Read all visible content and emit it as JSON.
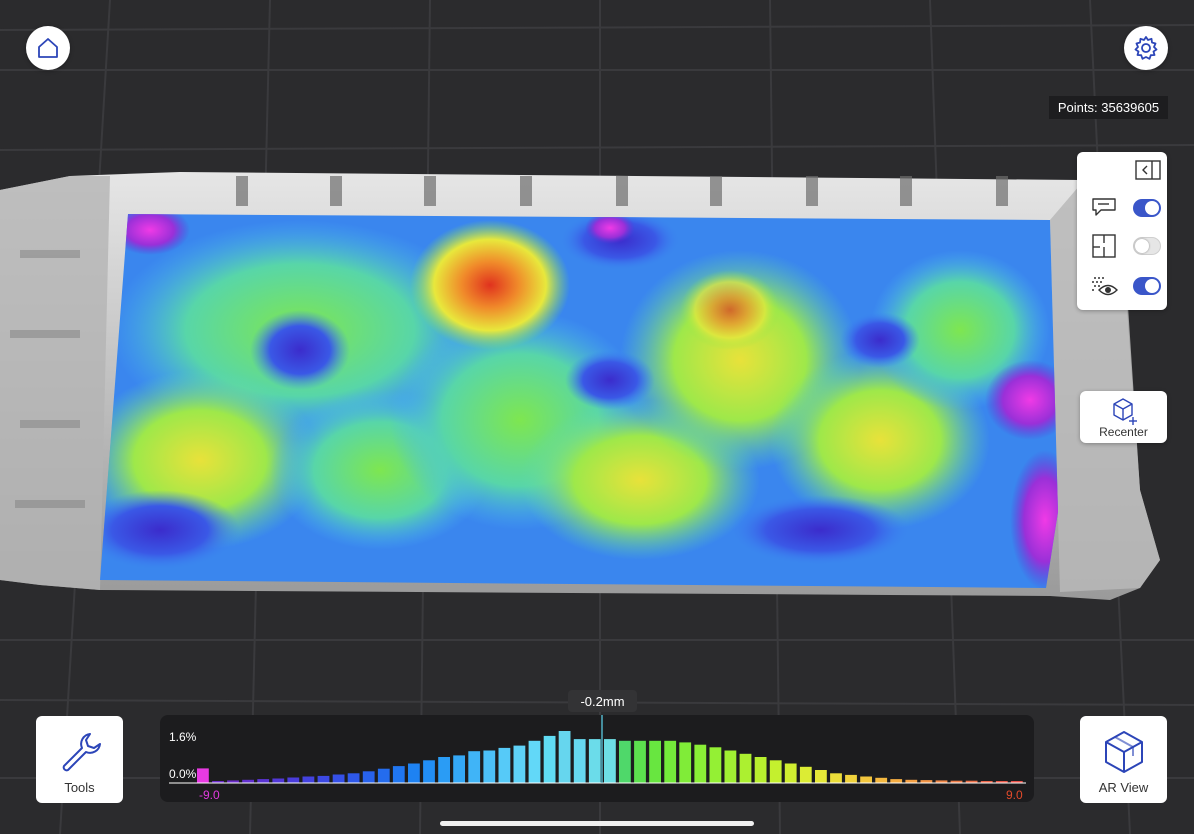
{
  "points": {
    "label": "Points: 35639605"
  },
  "layers": [
    {
      "name": "annotations",
      "on": true
    },
    {
      "name": "floor-plan",
      "on": false
    },
    {
      "name": "point-visibility",
      "on": true
    }
  ],
  "recenter": {
    "label": "Recenter"
  },
  "tools": {
    "label": "Tools"
  },
  "ar_view": {
    "label": "AR View"
  },
  "histogram": {
    "marker_label": "-0.2mm",
    "y_max_label": "1.6%",
    "y_min_label": "0.0%",
    "x_min_label": "-9.0",
    "x_max_label": "9.0"
  },
  "chart_data": {
    "type": "bar",
    "ylim": [
      0,
      1.6
    ],
    "values": [
      0.45,
      0.06,
      0.08,
      0.1,
      0.12,
      0.14,
      0.17,
      0.2,
      0.22,
      0.26,
      0.3,
      0.36,
      0.44,
      0.52,
      0.6,
      0.7,
      0.8,
      0.85,
      0.98,
      1.0,
      1.08,
      1.15,
      1.3,
      1.45,
      1.6,
      1.35,
      1.35,
      1.35,
      1.3,
      1.3,
      1.3,
      1.3,
      1.25,
      1.18,
      1.1,
      1.0,
      0.9,
      0.8,
      0.7,
      0.6,
      0.5,
      0.4,
      0.3,
      0.25,
      0.2,
      0.16,
      0.12,
      0.1,
      0.09,
      0.08,
      0.07,
      0.07,
      0.06,
      0.06,
      0.06,
      0.06,
      0.05,
      0.05,
      0.05,
      0.05,
      0.05,
      0.05,
      0.05,
      0.05,
      0.05,
      0.05,
      0.05,
      0.05,
      0.05,
      0.05,
      0.05,
      0.05,
      0.05,
      0.05,
      0.05,
      0.05,
      0.05,
      0.05,
      0.05,
      0.05,
      0.05,
      0.05,
      0.05,
      0.05,
      0.05,
      0.05,
      0.05,
      0.05,
      0.05,
      0.05,
      0.05,
      0.05,
      0.05,
      0.05,
      0.05,
      0.05,
      0.05,
      0.05,
      0.05,
      0.05,
      0.05,
      0.05,
      0.05,
      0.05,
      0.05,
      0.05,
      0.05,
      0.05,
      0.05,
      0.05,
      0.05,
      0.05,
      0.05,
      0.05,
      0.05,
      0.05,
      0.05,
      0.05,
      0.05,
      0.05,
      0.05,
      0.05,
      0.05,
      0.05,
      0.05,
      0.05,
      0.05,
      0.05,
      0.05,
      0.05,
      0.05,
      0.05,
      0.05,
      0.05,
      0.05,
      0.05,
      0.05,
      0.05,
      0.05,
      0.05,
      0.05,
      0.05,
      0.05,
      0.05,
      0.05,
      0.05,
      0.05,
      0.05,
      0.05,
      0.05,
      0.05,
      0.05,
      0.05,
      0.05,
      0.05,
      0.05,
      0.05,
      0.05,
      0.05,
      0.05,
      0.05,
      0.05,
      0.05,
      0.05,
      0.05,
      0.05,
      0.05,
      0.05
    ],
    "colors": [
      "#e83ae2",
      "#6b2cc9",
      "#6b2cc9",
      "#6230cf",
      "#5a34d4",
      "#5238d8",
      "#4a3cdc",
      "#4342e0",
      "#3c49e4",
      "#3550e8",
      "#2e58ea",
      "#2862ec",
      "#246cee",
      "#2076f0",
      "#1e82f2",
      "#228ef4",
      "#2a9cf5",
      "#34a8f6",
      "#40b4f7",
      "#4cc0f8",
      "#56caf8",
      "#5ed2f8",
      "#62d8f8",
      "#60dcf4",
      "#66d6ee",
      "#66d8ef",
      "#6bdcea",
      "#6edfe6",
      "#4fd86a",
      "#5ce04e",
      "#68e640",
      "#74ea3a",
      "#80ec38",
      "#8aee36",
      "#94f034",
      "#a0f032",
      "#acf030",
      "#b8f02e",
      "#c4f02e",
      "#d0ee30",
      "#dcec34",
      "#e6e838",
      "#ecde3a",
      "#f0d23c",
      "#f2c63e",
      "#f4b840",
      "#f4ac42",
      "#f4a044",
      "#f29446",
      "#f08848",
      "#ee7c48",
      "#ec7048",
      "#ea6448",
      "#e85848",
      "#e65048"
    ]
  }
}
